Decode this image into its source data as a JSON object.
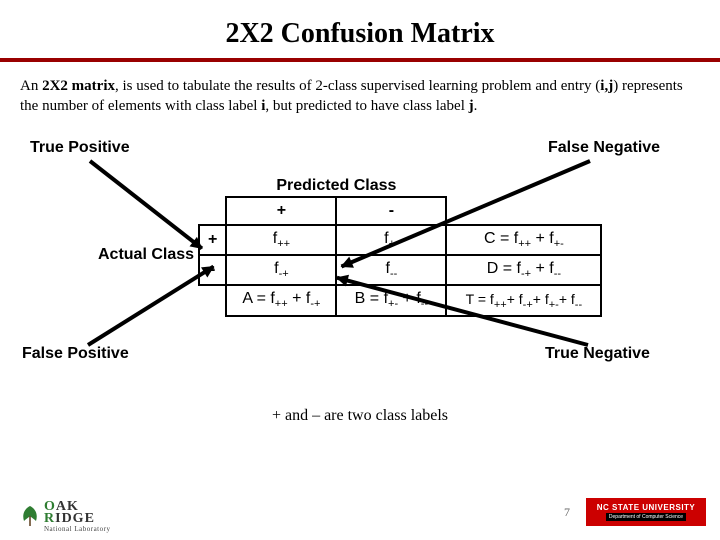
{
  "title": "2X2 Confusion Matrix",
  "paragraph": {
    "pre": "An ",
    "b1": "2X2 matrix",
    "mid1": ", is used to tabulate the results of 2-class supervised learning problem and entry (",
    "b2": "i,j",
    "mid2": ") represents the number of elements with class label ",
    "b3": "i",
    "mid3": ", but predicted to have class label ",
    "b4": "j",
    "end": "."
  },
  "labels": {
    "tp": "True Positive",
    "fn": "False Negative",
    "fp": "False Positive",
    "tn": "True Negative"
  },
  "table": {
    "predicted": "Predicted Class",
    "actual": "Actual Class",
    "col_plus": "+",
    "col_minus": "-",
    "row_plus": "+",
    "row_minus": "-",
    "cells": {
      "fpp": "f",
      "fpm": "f",
      "fmp": "f",
      "fmm": "f"
    },
    "subs": {
      "pp": "++",
      "pm": "+-",
      "mp": "-+",
      "mm": "--"
    },
    "rowtotals": {
      "c_label": "C = f",
      "c_sub1": "++",
      "c_mid": " + f",
      "c_sub2": "+-",
      "d_label": "D = f",
      "d_sub1": "-+",
      "d_mid": " + f",
      "d_sub2": "--"
    },
    "coltotals": {
      "a_label": "A = f",
      "a_sub1": "++",
      "a_mid": " + f",
      "a_sub2": "-+",
      "b_label": "B = f",
      "b_sub1": "+-",
      "b_mid": " + f",
      "b_sub2": "--",
      "t_label": "T = f",
      "t_sub1": "++",
      "t_mid1": "+ f",
      "t_sub2": "-+",
      "t_mid2": "+ f",
      "t_sub3": "+-",
      "t_mid3": "+ f",
      "t_sub4": "--"
    }
  },
  "footnote": "+ and – are two class labels",
  "page_number": "7",
  "logos": {
    "oakridge_top1": "O",
    "oakridge_top2": "AK",
    "oakridge_top3": "R",
    "oakridge_top4": "IDGE",
    "oakridge_sub": "National Laboratory",
    "ncsu_top": "NC STATE UNIVERSITY",
    "ncsu_sub": "Department of Computer Science"
  }
}
